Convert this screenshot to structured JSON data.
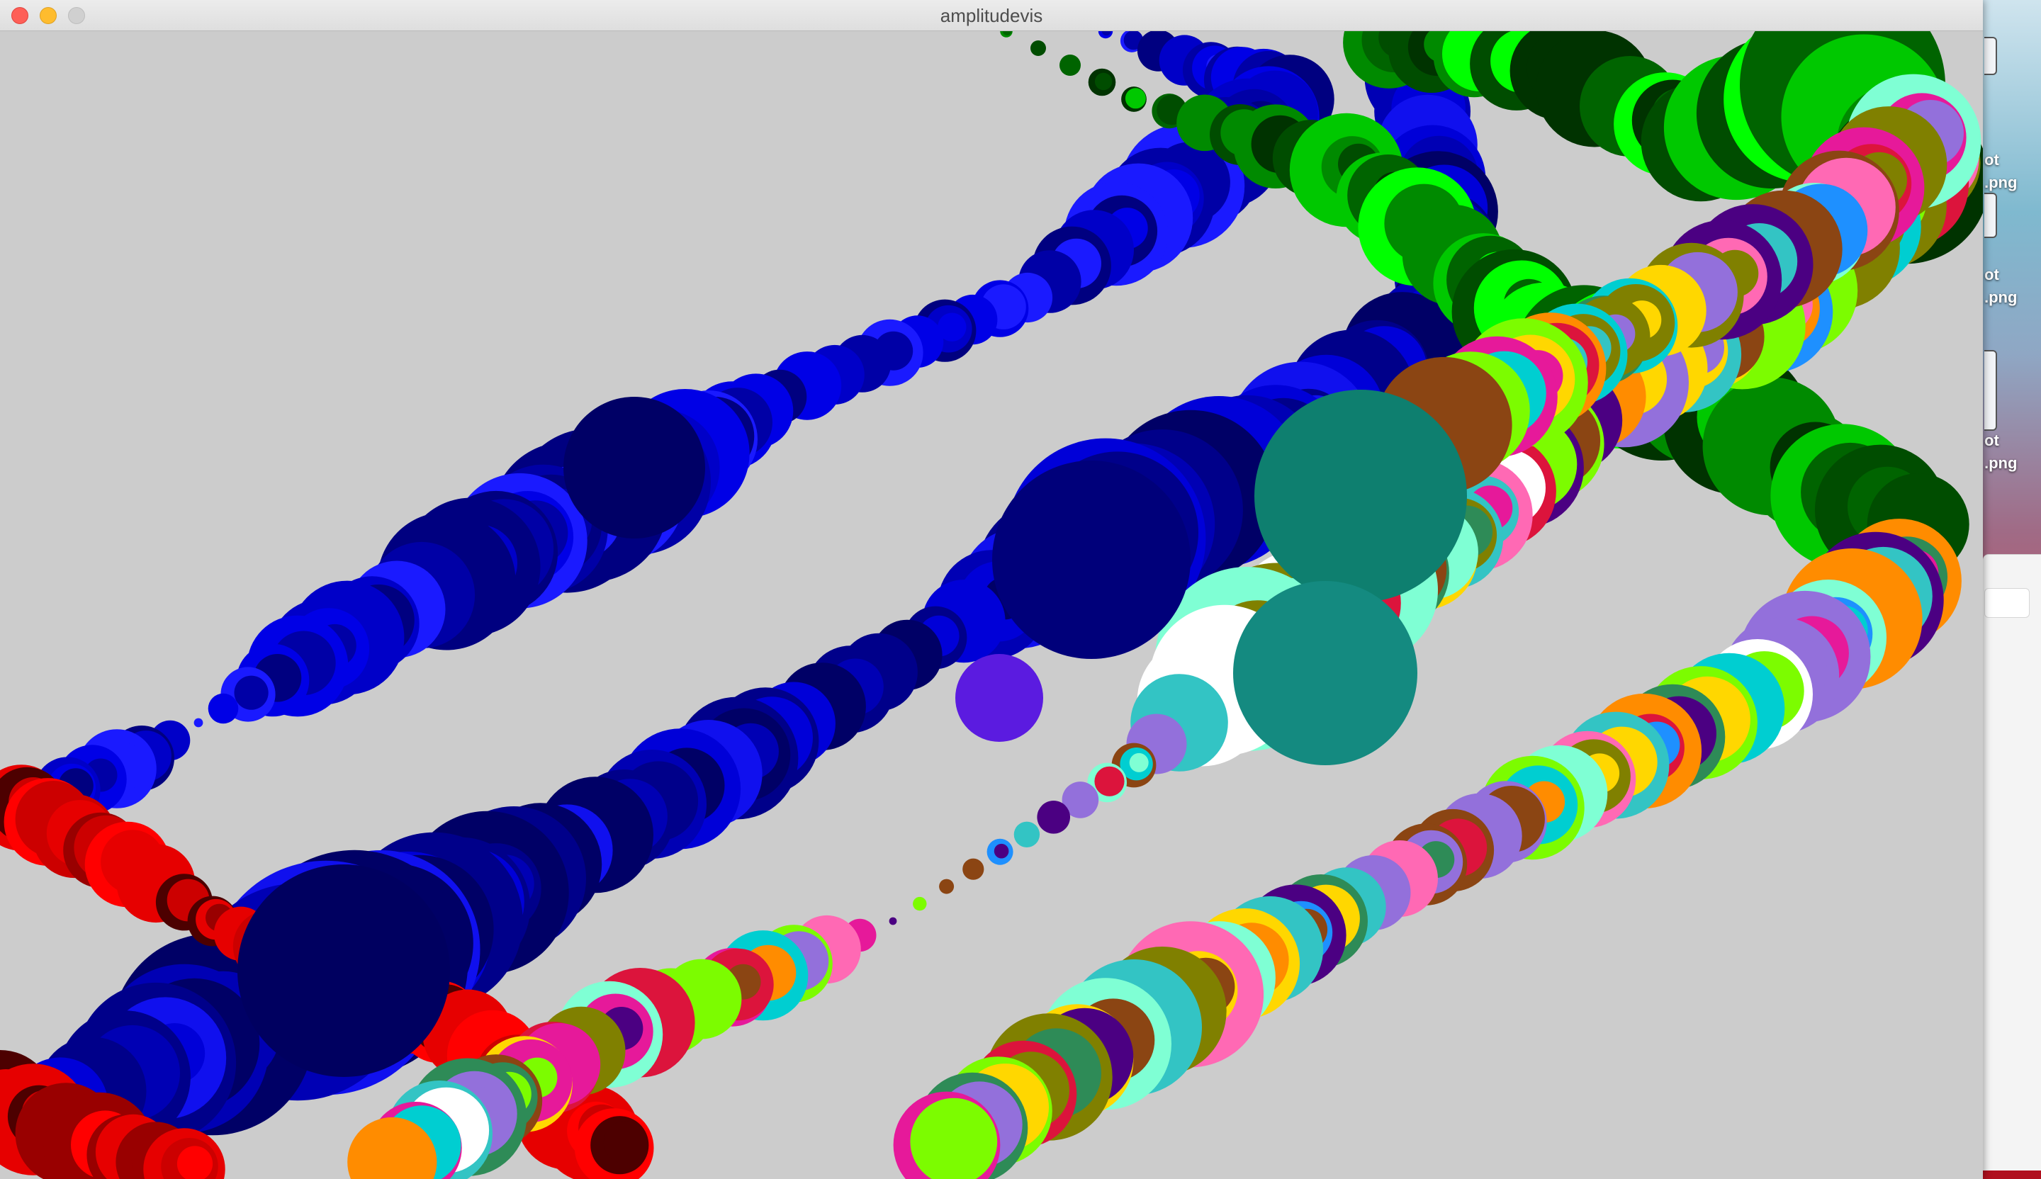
{
  "window": {
    "title": "amplitudevis",
    "background_color": "#cccccc",
    "controls": [
      "close-icon",
      "minimize-icon",
      "zoom-icon"
    ]
  },
  "desktop": {
    "icons": [
      {
        "label": "ot\n.png"
      },
      {
        "label": "ot\n.png"
      },
      {
        "label": "ot\n.png"
      }
    ]
  },
  "visualization": {
    "series_colors": {
      "blue_upper": [
        "#0000e6",
        "#0000c8",
        "#0000a6",
        "#000080",
        "#1a1aff"
      ],
      "blue_lower": [
        "#00008a",
        "#0000b4",
        "#0000d8",
        "#000066",
        "#1010ee"
      ],
      "green": [
        "#006400",
        "#00c800",
        "#00ff00",
        "#004d00",
        "#008a00",
        "#003300"
      ],
      "red": [
        "#ff0000",
        "#cc0000",
        "#990000",
        "#4d0000",
        "#e60000"
      ],
      "multi": [
        "#e6199a",
        "#33c4c4",
        "#ffd700",
        "#7cfc00",
        "#9370db",
        "#ff8c00",
        "#1e90ff",
        "#2e8b57",
        "#ff69b4",
        "#8b4513",
        "#00ced1",
        "#ffffff",
        "#808000",
        "#4b0082",
        "#7fffd4",
        "#dc143c"
      ],
      "accents": [
        "#0e7f6f",
        "#5b1be0",
        "#148a80"
      ]
    }
  }
}
